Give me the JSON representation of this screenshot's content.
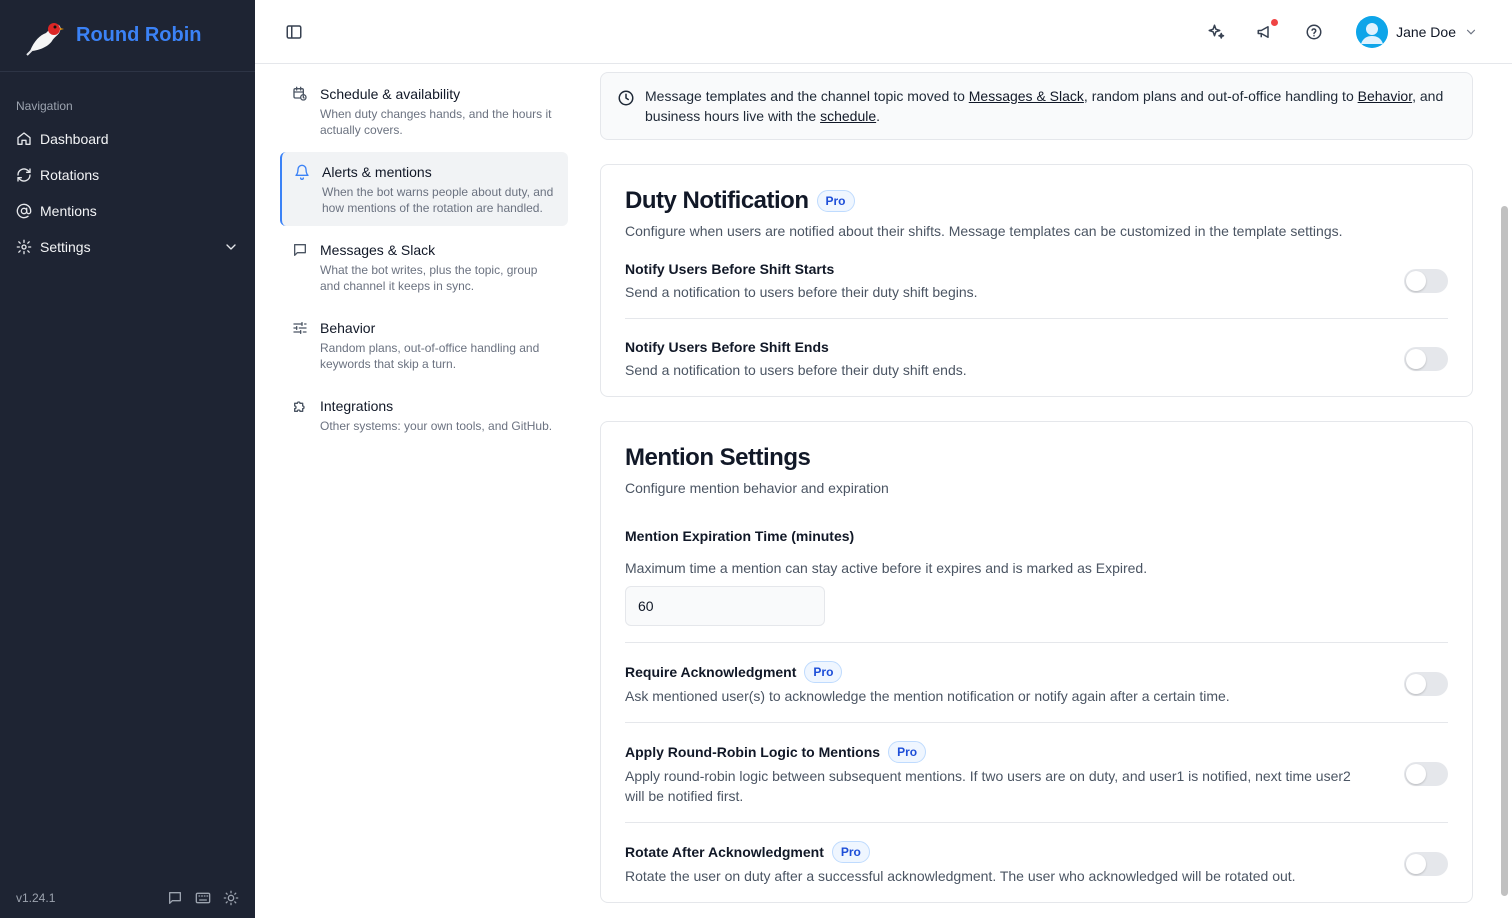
{
  "app": {
    "name": "Round Robin",
    "version": "v1.24.1"
  },
  "sidebar": {
    "section_label": "Navigation",
    "items": [
      {
        "label": "Dashboard",
        "icon": "home-icon"
      },
      {
        "label": "Rotations",
        "icon": "refresh-icon"
      },
      {
        "label": "Mentions",
        "icon": "at-sign-icon"
      },
      {
        "label": "Settings",
        "icon": "gear-icon"
      }
    ]
  },
  "header": {
    "user_name": "Jane Doe"
  },
  "subnav": [
    {
      "title": "Schedule & availability",
      "desc": "When duty changes hands, and the hours it actually covers.",
      "icon": "calendar-clock-icon"
    },
    {
      "title": "Alerts & mentions",
      "desc": "When the bot warns people about duty, and how mentions of the rotation are handled.",
      "icon": "bell-icon"
    },
    {
      "title": "Messages & Slack",
      "desc": "What the bot writes, plus the topic, group and channel it keeps in sync.",
      "icon": "message-square-icon"
    },
    {
      "title": "Behavior",
      "desc": "Random plans, out-of-office handling and keywords that skip a turn.",
      "icon": "sliders-icon"
    },
    {
      "title": "Integrations",
      "desc": "Other systems: your own tools, and GitHub.",
      "icon": "puzzle-icon"
    }
  ],
  "info": {
    "t1": "Message templates and the channel topic moved to ",
    "link1": "Messages & Slack",
    "t2": ", random plans and out-of-office handling to ",
    "link2": "Behavior",
    "t3": ", and business hours live with the ",
    "link3": "schedule",
    "t4": "."
  },
  "duty": {
    "title": "Duty Notification",
    "badge": "Pro",
    "desc": "Configure when users are notified about their shifts. Message templates can be customized in the template settings.",
    "rows": [
      {
        "label": "Notify Users Before Shift Starts",
        "desc": "Send a notification to users before their duty shift begins.",
        "enabled": false
      },
      {
        "label": "Notify Users Before Shift Ends",
        "desc": "Send a notification to users before their duty shift ends.",
        "enabled": false
      }
    ]
  },
  "mention": {
    "title": "Mention Settings",
    "desc": "Configure mention behavior and expiration",
    "expiration_label": "Mention Expiration Time (minutes)",
    "expiration_help": "Maximum time a mention can stay active before it expires and is marked as Expired.",
    "expiration_value": "60",
    "rows": [
      {
        "label": "Require Acknowledgment",
        "badge": "Pro",
        "desc": "Ask mentioned user(s) to acknowledge the mention notification or notify again after a certain time.",
        "enabled": false
      },
      {
        "label": "Apply Round-Robin Logic to Mentions",
        "badge": "Pro",
        "desc": "Apply round-robin logic between subsequent mentions. If two users are on duty, and user1 is notified, next time user2 will be notified first.",
        "enabled": false
      },
      {
        "label": "Rotate After Acknowledgment",
        "badge": "Pro",
        "desc": "Rotate the user on duty after a successful acknowledgment. The user who acknowledged will be rotated out.",
        "enabled": false
      }
    ]
  },
  "colors": {
    "accent": "#3b82f6",
    "sidebar_bg": "#1e2433",
    "notification_dot": "#ef4444"
  }
}
